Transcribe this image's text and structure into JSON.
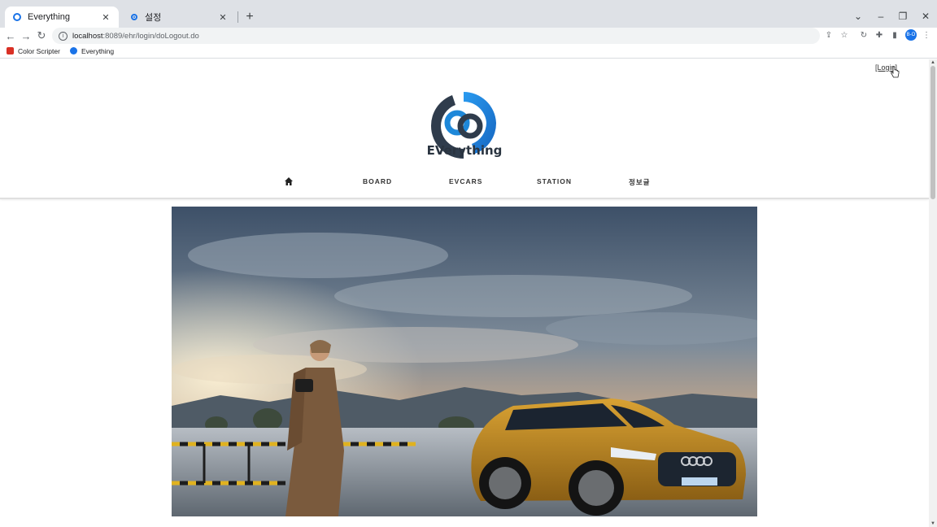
{
  "browser": {
    "tabs": [
      {
        "title": "Everything",
        "active": true
      },
      {
        "title": "설정",
        "active": false
      }
    ],
    "url_host": "localhost",
    "url_path": ":8089/ehr/login/doLogout.do",
    "profile_initials": "B-O",
    "bookmarks": [
      {
        "label": "Color Scripter",
        "color": "#d93025"
      },
      {
        "label": "Everything",
        "color": "#1a73e8"
      }
    ]
  },
  "site": {
    "login_label": "[Login]",
    "logo_text": "EVerything",
    "nav": [
      {
        "label": "BOARD"
      },
      {
        "label": "EVCARS"
      },
      {
        "label": "STATION"
      },
      {
        "label": "정보글"
      }
    ],
    "hero_alt": "",
    "colors": {
      "logo_blue": "#1e88d9",
      "logo_dark": "#2a3440"
    }
  }
}
